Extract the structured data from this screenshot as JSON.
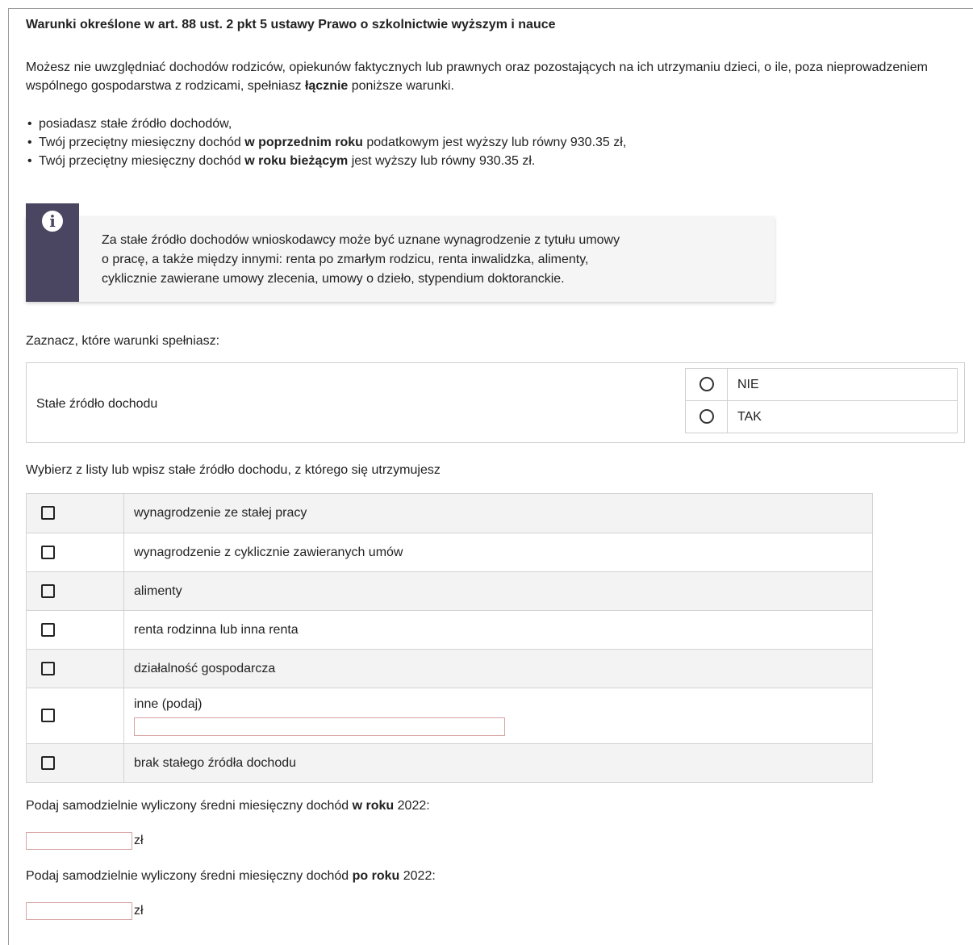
{
  "heading": "Warunki określone w art. 88 ust. 2 pkt 5 ustawy Prawo o szkolnictwie wyższym i nauce",
  "intro": {
    "before": "Możesz nie uwzględniać dochodów rodziców, opiekunów faktycznych lub prawnych oraz pozostających na ich utrzymaniu dzieci, o ile, poza nieprowadzeniem wspólnego gospodarstwa z rodzicami, spełniasz ",
    "bold": "łącznie",
    "after": " poniższe warunki."
  },
  "bullets": [
    {
      "before": "posiadasz stałe źródło dochodów,",
      "bold": "",
      "after": ""
    },
    {
      "before": "Twój przeciętny miesięczny dochód ",
      "bold": "w poprzednim roku",
      "after": " podatkowym jest wyższy lub równy 930.35 zł,"
    },
    {
      "before": "Twój przeciętny miesięczny dochód ",
      "bold": "w roku bieżącym",
      "after": " jest wyższy lub równy 930.35 zł."
    }
  ],
  "info": {
    "icon": "info-icon",
    "lines": [
      "Za stałe źródło dochodów wnioskodawcy może być uznane wynagrodzenie z tytułu umowy",
      "o pracę, a także między innymi: renta po zmarłym rodzicu, renta inwalidzka, alimenty,",
      "cyklicznie zawierane umowy zlecenia, umowy o dzieło, stypendium doktoranckie."
    ]
  },
  "conditions_prompt": "Zaznacz, które warunki spełniasz:",
  "stable_income": {
    "label": "Stałe źródło dochodu",
    "options": [
      "NIE",
      "TAK"
    ]
  },
  "sources_prompt": "Wybierz z listy lub wpisz stałe źródło dochodu, z którego się utrzymujesz",
  "sources": [
    "wynagrodzenie ze stałej pracy",
    "wynagrodzenie z cyklicznie zawieranych umów",
    "alimenty",
    "renta rodzinna lub inna renta",
    "działalność gospodarcza",
    "inne (podaj)",
    "brak stałego źródła dochodu"
  ],
  "income_in_year": {
    "before": "Podaj samodzielnie wyliczony średni miesięczny dochód ",
    "bold": "w roku",
    "after": " 2022:",
    "unit": "zł"
  },
  "income_after_year": {
    "before": "Podaj samodzielnie wyliczony średni miesięczny dochód ",
    "bold": "po roku",
    "after": " 2022:",
    "unit": "zł"
  }
}
